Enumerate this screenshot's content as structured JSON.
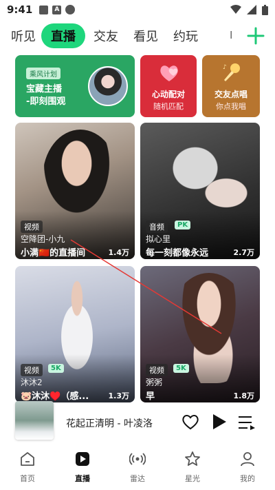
{
  "status_bar": {
    "time": "9:41"
  },
  "tabs": [
    {
      "label": "听见"
    },
    {
      "label": "直播",
      "active": true
    },
    {
      "label": "交友"
    },
    {
      "label": "看见"
    },
    {
      "label": "约玩"
    },
    {
      "label": "I"
    }
  ],
  "feature_cards": {
    "green": {
      "badge": "乘风计划",
      "line1": "宝藏主播",
      "line2": "-即刻围观"
    },
    "red": {
      "title": "心动配对",
      "subtitle": "随机匹配"
    },
    "brown": {
      "title": "交友点唱",
      "subtitle": "你点我唱"
    }
  },
  "tiles": [
    {
      "tag": "视频",
      "name": "空降团-小九",
      "title": "小满🇨🇳的直播间",
      "count": "1.4万"
    },
    {
      "tag": "音频",
      "pk": "PK",
      "name": "拟心里",
      "title": "每一刻都像永远",
      "count": "2.7万"
    },
    {
      "tag": "视频",
      "pk": "5K",
      "name": "沐沐2",
      "title": "🐷沐沐♥️（感...",
      "count": "1.3万"
    },
    {
      "tag": "视频",
      "pk": "5K",
      "name": "粥粥",
      "title": "早",
      "count": "1.8万"
    }
  ],
  "player": {
    "song": "花起正清明 - 叶凌洛"
  },
  "bottom_nav": [
    {
      "label": "首页",
      "icon": "home-icon"
    },
    {
      "label": "直播",
      "icon": "live-play-icon",
      "active": true
    },
    {
      "label": "雷达",
      "icon": "radar-icon"
    },
    {
      "label": "星光",
      "icon": "star-icon"
    },
    {
      "label": "我的",
      "icon": "profile-icon"
    }
  ],
  "colors": {
    "accent": "#1ed67c",
    "red_card": "#d92d3a",
    "green_card": "#2aa663",
    "brown_card": "#b7752f"
  }
}
